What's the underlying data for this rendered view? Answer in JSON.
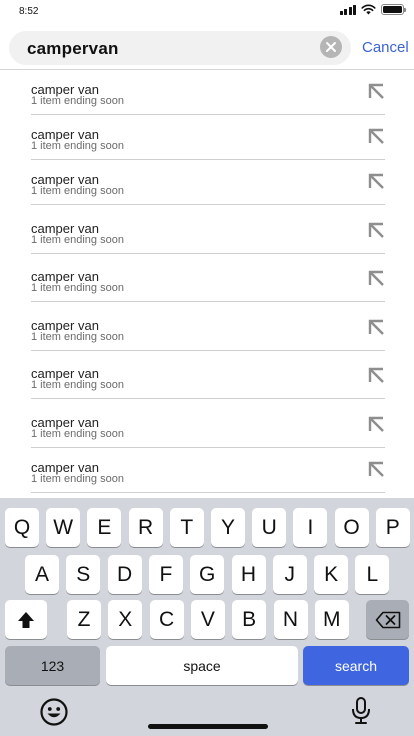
{
  "status_bar": {
    "time": "8:52"
  },
  "search": {
    "query": "campervan",
    "cancel_label": "Cancel"
  },
  "suggestions": [
    {
      "title": "camper van",
      "subtitle": "1 item ending soon"
    },
    {
      "title": "camper van",
      "subtitle": "1 item ending soon"
    },
    {
      "title": "camper van",
      "subtitle": "1 item ending soon"
    },
    {
      "title": "camper van",
      "subtitle": "1 item ending soon"
    },
    {
      "title": "camper van",
      "subtitle": "1 item ending soon"
    },
    {
      "title": "camper van",
      "subtitle": "1 item ending soon"
    },
    {
      "title": "camper van",
      "subtitle": "1 item ending soon"
    },
    {
      "title": "camper van",
      "subtitle": "1 item ending soon"
    },
    {
      "title": "camper van",
      "subtitle": "1 item ending soon"
    }
  ],
  "keyboard": {
    "row1": [
      "Q",
      "W",
      "E",
      "R",
      "T",
      "Y",
      "U",
      "I",
      "O",
      "P"
    ],
    "row2": [
      "A",
      "S",
      "D",
      "F",
      "G",
      "H",
      "J",
      "K",
      "L"
    ],
    "row3": [
      "Z",
      "X",
      "C",
      "V",
      "B",
      "N",
      "M"
    ],
    "numbers_label": "123",
    "space_label": "space",
    "return_label": "search"
  },
  "colors": {
    "accent": "#3f66e0",
    "link": "#3b63d6",
    "keyboard_bg": "#d2d5db"
  }
}
